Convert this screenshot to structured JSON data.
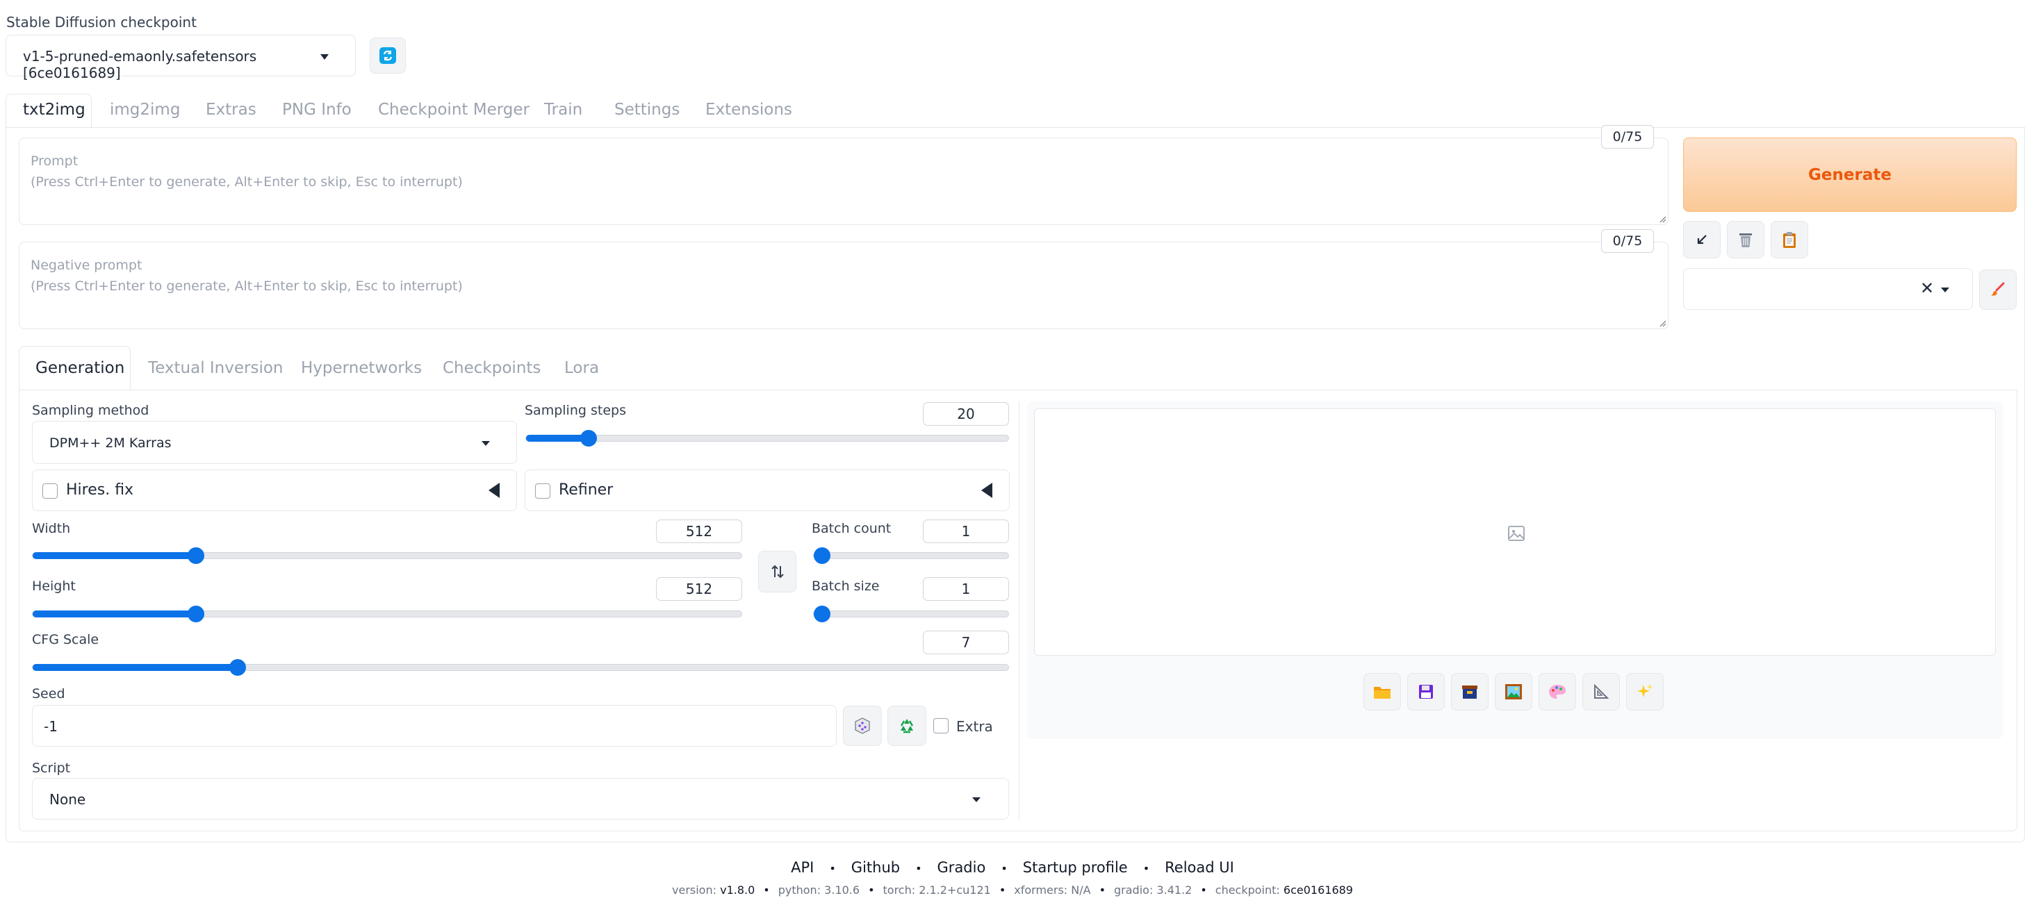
{
  "checkpoint": {
    "label": "Stable Diffusion checkpoint",
    "value": "v1-5-pruned-emaonly.safetensors [6ce0161689]"
  },
  "tabs": [
    "txt2img",
    "img2img",
    "Extras",
    "PNG Info",
    "Checkpoint Merger",
    "Train",
    "Settings",
    "Extensions"
  ],
  "prompt": {
    "placeholder": "Prompt\n(Press Ctrl+Enter to generate, Alt+Enter to skip, Esc to interrupt)",
    "counter": "0/75"
  },
  "negative_prompt": {
    "placeholder": "Negative prompt\n(Press Ctrl+Enter to generate, Alt+Enter to skip, Esc to interrupt)",
    "counter": "0/75"
  },
  "generate_label": "Generate",
  "subtabs": [
    "Generation",
    "Textual Inversion",
    "Hypernetworks",
    "Checkpoints",
    "Lora"
  ],
  "sampling_method": {
    "label": "Sampling method",
    "value": "DPM++ 2M Karras"
  },
  "sampling_steps": {
    "label": "Sampling steps",
    "value": "20",
    "fraction": 0.13
  },
  "hires_fix": {
    "label": "Hires. fix",
    "checked": false
  },
  "refiner": {
    "label": "Refiner",
    "checked": false
  },
  "width": {
    "label": "Width",
    "value": "512",
    "fraction": 0.23
  },
  "height": {
    "label": "Height",
    "value": "512",
    "fraction": 0.23
  },
  "batch_count": {
    "label": "Batch count",
    "value": "1",
    "fraction": 0.0
  },
  "batch_size": {
    "label": "Batch size",
    "value": "1",
    "fraction": 0.0
  },
  "cfg_scale": {
    "label": "CFG Scale",
    "value": "7",
    "fraction": 0.21
  },
  "seed": {
    "label": "Seed",
    "value": "-1",
    "extra_label": "Extra"
  },
  "script": {
    "label": "Script",
    "value": "None"
  },
  "footer": {
    "links": [
      "API",
      "Github",
      "Gradio",
      "Startup profile",
      "Reload UI"
    ],
    "version_label": "version:",
    "version": "v1.8.0",
    "python_label": "python:",
    "python": "3.10.6",
    "torch_label": "torch:",
    "torch": "2.1.2+cu121",
    "xformers_label": "xformers:",
    "xformers": "N/A",
    "gradio_label": "gradio:",
    "gradio": "3.41.2",
    "checkpoint_label": "checkpoint:",
    "checkpoint": "6ce0161689"
  },
  "colors": {
    "accent": "#0b72e7",
    "generate_text": "#ea580c"
  }
}
